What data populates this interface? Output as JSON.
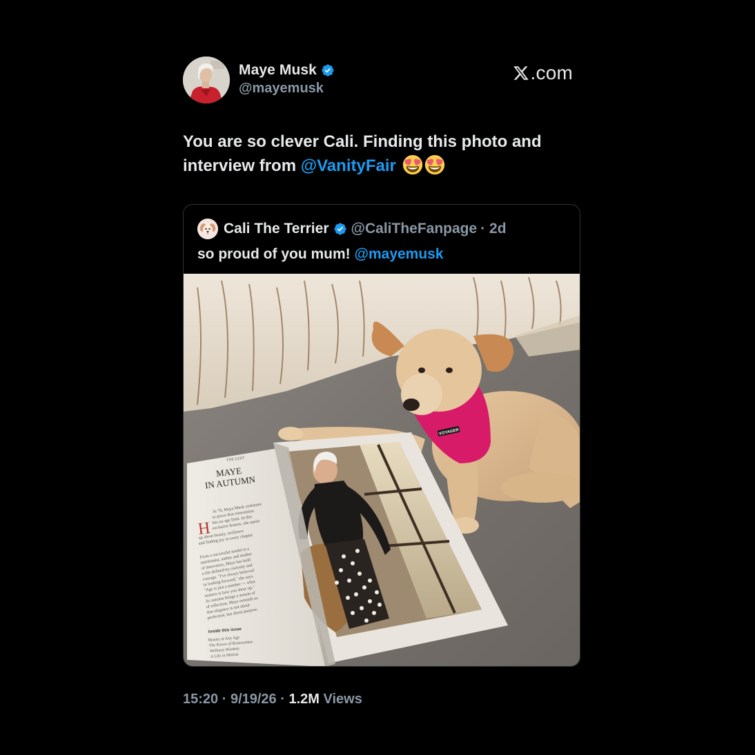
{
  "tweet": {
    "author_name": "Maye Musk",
    "author_handle": "@mayemusk",
    "brand": ".com",
    "text_prefix": "You are so clever Cali. Finding this photo and interview from ",
    "text_mention": "@VanityFair",
    "emojis": [
      "smiling-face-with-heart-eyes",
      "smiling-face-with-heart-eyes"
    ]
  },
  "quoted": {
    "author_name": "Cali The Terrier",
    "author_handle": "@CaliTheFanpage",
    "age": "· 2d",
    "text_prefix": "so proud of you mum! ",
    "text_mention": "@mayemusk",
    "photo": {
      "harness_label": "VOYAGER",
      "magazine": {
        "kicker": "THE EDIT",
        "headline_line1": "MAYE",
        "headline_line2": "IN AUTUMN",
        "dropcap": "H",
        "body": [
          "At 76, Maye Musk continues",
          "to prove that reinvention",
          "has no age limit. In this",
          "exclusive feature, she opens",
          "up about beauty, resilience",
          "and finding joy in every chapter."
        ],
        "body2": [
          "From a successful model to a",
          "nutritionist, author and mother",
          "of innovators, Maye has built",
          "a life defined by curiosity and",
          "courage. \"I've always believed",
          "in looking forward,\" she says.",
          "\"Age is just a number — what",
          "matters is how you show up.\"",
          "As autumn brings a season of",
          "of reflection, Maye reminds us",
          "that elegance is not about",
          "perfection, but about purpose."
        ],
        "inside_title": "Inside this issue",
        "inside_items": [
          "Beauty at Any Age",
          "The Power of Reinvention",
          "Wellness Wisdom",
          "A Life in Motion"
        ]
      }
    }
  },
  "footer": {
    "time": "15:20",
    "date": "9/19/26",
    "views_count": "1.2M",
    "views_label": "Views"
  },
  "colors": {
    "background": "#000000",
    "text": "#e7e9ea",
    "muted": "#8b98a5",
    "mention": "#1d9bf0",
    "verified": "#1d9bf0",
    "border": "#2f3336"
  }
}
